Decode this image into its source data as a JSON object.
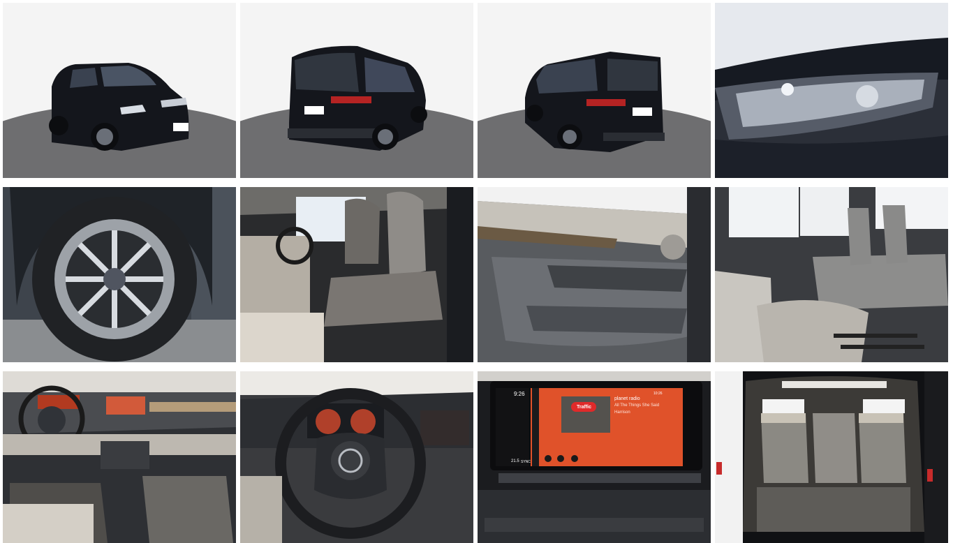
{
  "gallery": {
    "photos": [
      {
        "name": "photo-exterior-front-three-quarter",
        "alt": "Exterior front three-quarter view"
      },
      {
        "name": "photo-exterior-rear-left",
        "alt": "Exterior rear view left"
      },
      {
        "name": "photo-exterior-rear-right",
        "alt": "Exterior rear view right"
      },
      {
        "name": "photo-headlight-detail",
        "alt": "Headlight detail"
      },
      {
        "name": "photo-wheel-detail",
        "alt": "Wheel detail"
      },
      {
        "name": "photo-front-seats",
        "alt": "Front seats"
      },
      {
        "name": "photo-door-panel",
        "alt": "Door panel"
      },
      {
        "name": "photo-rear-seats",
        "alt": "Rear seats"
      },
      {
        "name": "photo-dashboard",
        "alt": "Dashboard"
      },
      {
        "name": "photo-steering-wheel",
        "alt": "Steering wheel"
      },
      {
        "name": "photo-infotainment-screen",
        "alt": "Infotainment screen"
      },
      {
        "name": "photo-trunk",
        "alt": "Trunk interior"
      }
    ]
  },
  "infotainment": {
    "time": "9:26",
    "temp": "21.5",
    "sync": "SYNC",
    "station": "planet radio",
    "song": "All The Things She Said",
    "artist": "Harrison",
    "badge": "Traffic",
    "clock_small": "10:26"
  },
  "colors": {
    "screen_orange": "#e0522a",
    "badge_red": "#e02a2a",
    "vehicle_black": "#14161c",
    "studio_floor": "#6e6e70"
  }
}
